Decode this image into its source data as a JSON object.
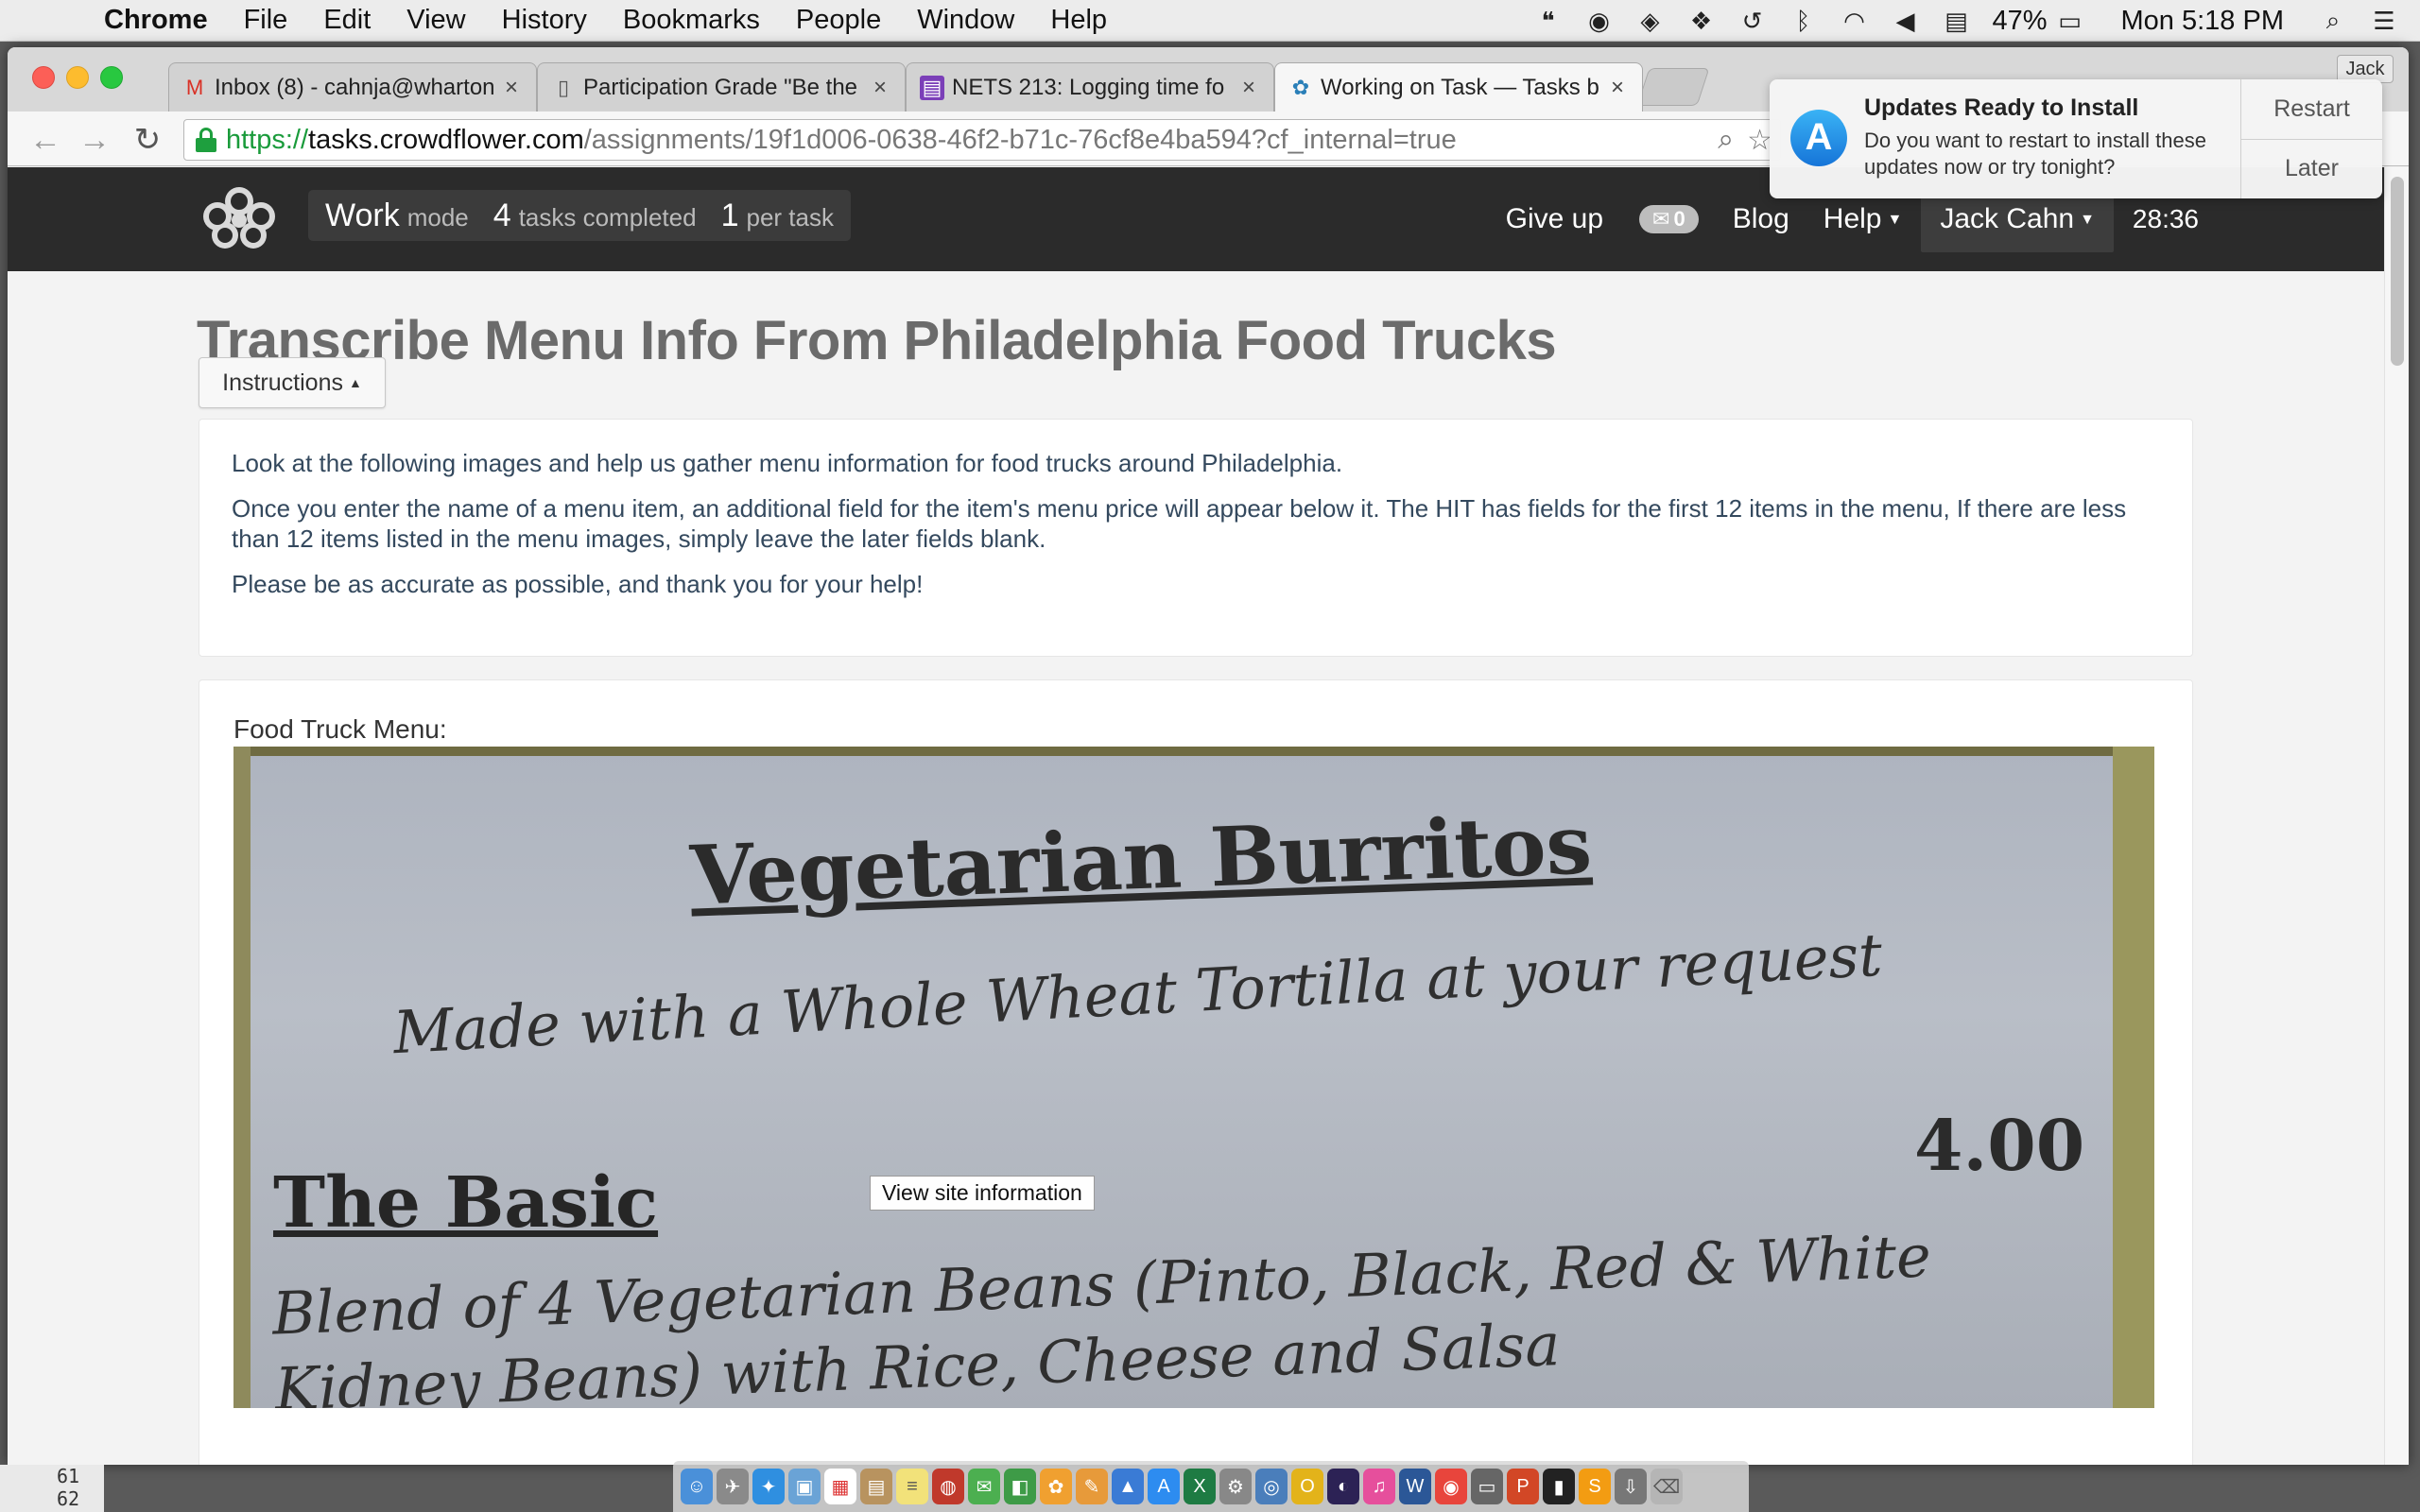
{
  "menubar": {
    "app": "Chrome",
    "items": [
      "File",
      "Edit",
      "View",
      "History",
      "Bookmarks",
      "People",
      "Window",
      "Help"
    ],
    "battery": "47%",
    "clock": "Mon 5:18 PM"
  },
  "tabs": [
    {
      "icon": "gmail-icon",
      "glyph": "M",
      "color": "#d93025",
      "title": "Inbox (8) - cahnja@wharton"
    },
    {
      "icon": "document-icon",
      "glyph": "▯",
      "color": "#555555",
      "title": "Participation Grade \"Be the"
    },
    {
      "icon": "sheets-icon",
      "glyph": "▤",
      "color": "#7b3fb8",
      "title": "NETS 213: Logging time fo"
    },
    {
      "icon": "crowdflower-icon",
      "glyph": "✿",
      "color": "#2a7fb8",
      "title": "Working on Task — Tasks b"
    }
  ],
  "profile": "Jack",
  "omnibox": {
    "scheme": "https://",
    "host": "tasks.crowdflower.com",
    "path": "/assignments/19f1d006-0638-46f2-b71c-76cf8e4ba594?cf_internal=true"
  },
  "notification": {
    "title": "Updates Ready to Install",
    "text": "Do you want to restart to install these updates now or try tonight?",
    "restart": "Restart",
    "later": "Later"
  },
  "cf_nav": {
    "work": "Work",
    "mode": "mode",
    "tasks_count": "4",
    "tasks_label": "tasks completed",
    "per_count": "1",
    "per_label": "per task",
    "give_up": "Give up",
    "messages": "0",
    "blog": "Blog",
    "help": "Help",
    "user": "Jack Cahn",
    "timer": "28:36"
  },
  "page": {
    "title": "Transcribe Menu Info From Philadelphia Food Trucks",
    "instructions_button": "Instructions",
    "instructions": [
      "Look at the following images and help us gather menu information for food trucks around Philadelphia.",
      "Once you enter the name of a menu item, an additional field for the item's menu price will appear below it. The HIT has fields for the first 12 items in the menu, If there are less than 12 items listed in the menu images, simply leave the later fields blank.",
      "Please be as accurate as possible, and thank you for your help!"
    ],
    "menu_label": "Food Truck Menu:",
    "tooltip": "View site information"
  },
  "menu_photo": {
    "heading": "Vegetarian Burritos",
    "subheading": "Made with a Whole Wheat Tortilla at your request",
    "item": "The Basic",
    "price": "4.00",
    "desc_line1": "Blend of 4 Vegetarian Beans (Pinto, Black, Red & White",
    "desc_line2": "Kidney Beans) with Rice, Cheese and Salsa"
  },
  "background_text": [
    "61",
    "62"
  ]
}
